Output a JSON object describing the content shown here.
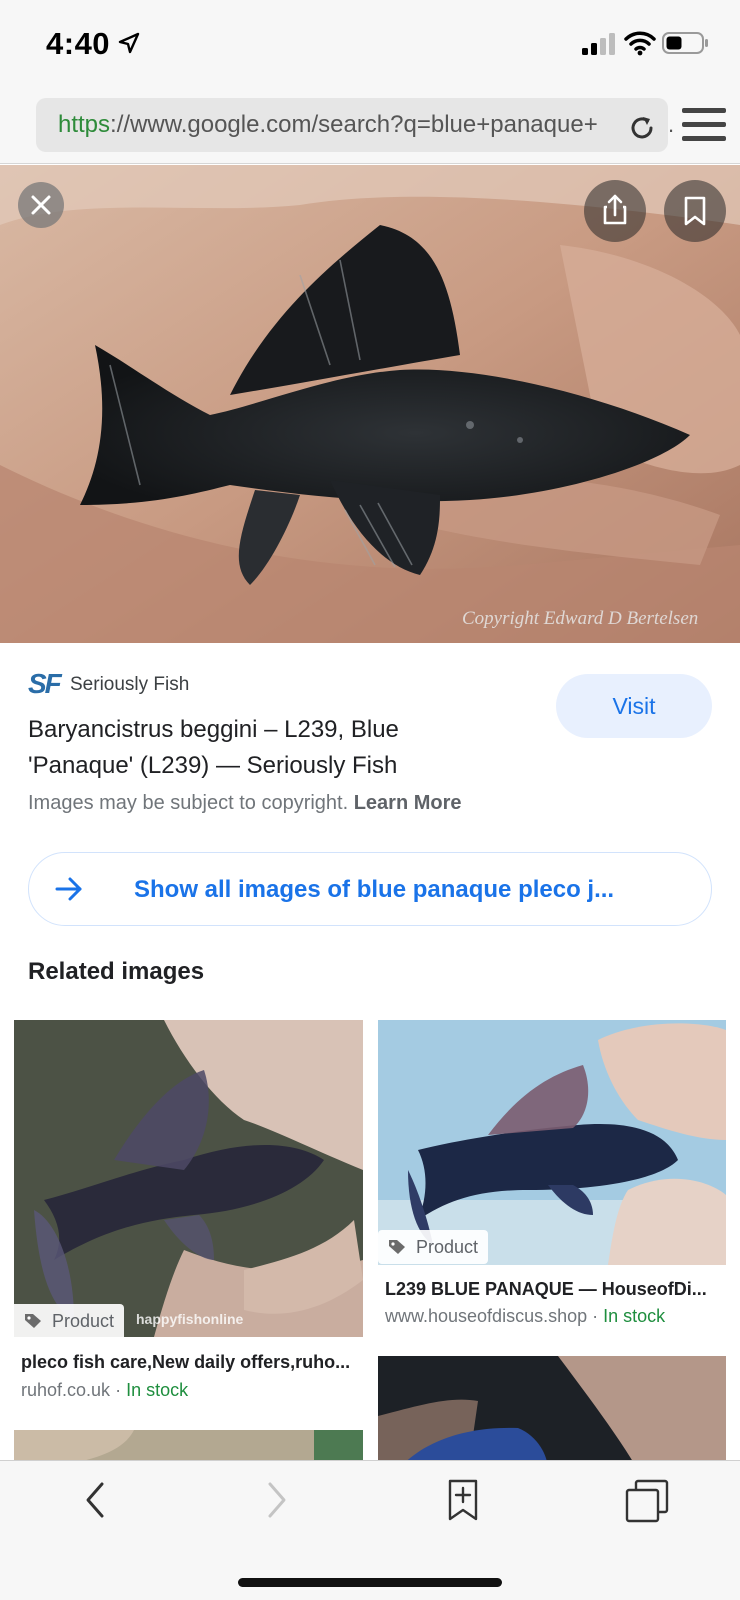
{
  "status_bar": {
    "time": "4:40"
  },
  "browser": {
    "url_scheme": "https",
    "url_rest": "://www.google.com/search?q=blue+panaque+",
    "url_overflow": "."
  },
  "hero": {
    "copyright": "Copyright Edward D Bertelsen"
  },
  "result": {
    "source_logo": "SF",
    "source_name": "Seriously Fish",
    "visit_label": "Visit",
    "title": "Baryancistrus beggini – L239, Blue 'Panaque' (L239) — Seriously Fish",
    "copyright_note": "Images may be subject to copyright.",
    "learn_more": "Learn More"
  },
  "show_all": {
    "label": "Show all images of blue panaque pleco j..."
  },
  "related": {
    "heading": "Related images",
    "items": [
      {
        "badge": "Product",
        "watermark": "happyfishonline",
        "title": "pleco fish care,New daily offers,ruho...",
        "domain": "ruhof.co.uk",
        "separator": " · ",
        "stock": "In stock"
      },
      {
        "badge": "Product",
        "title": "L239 BLUE PANAQUE — HouseofDi...",
        "domain": "www.houseofdiscus.shop",
        "separator": " · ",
        "stock": "In stock"
      }
    ]
  },
  "colors": {
    "accent_blue": "#1a73e8",
    "visit_bg": "#e8f0fe",
    "in_stock_green": "#1e8e3e",
    "url_scheme_green": "#2e8b3a"
  },
  "icons": [
    "location-arrow-icon",
    "signal-icon",
    "wifi-icon",
    "battery-icon",
    "reload-icon",
    "menu-icon",
    "close-icon",
    "share-icon",
    "bookmark-icon",
    "arrow-right-icon",
    "tag-icon",
    "back-icon",
    "forward-icon",
    "add-bookmark-icon",
    "tabs-icon"
  ]
}
